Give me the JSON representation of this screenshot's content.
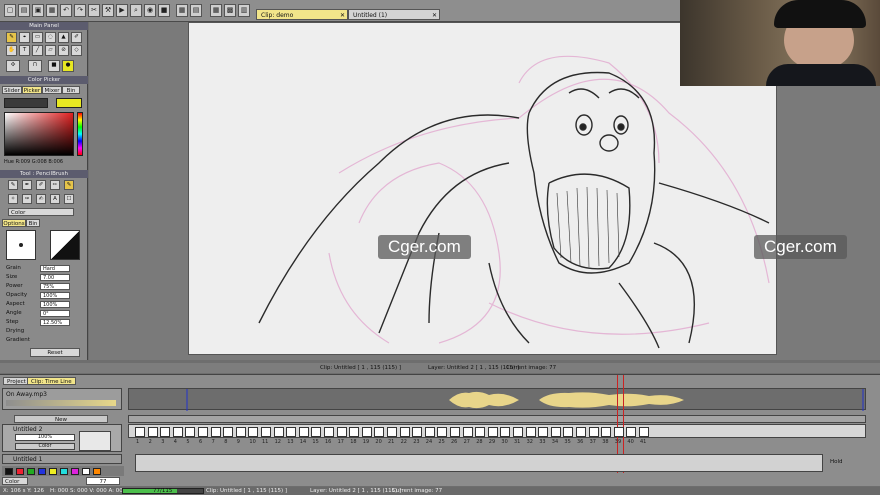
{
  "toolbar": {
    "tabs": [
      {
        "label": "Clip: demo",
        "active": true
      },
      {
        "label": "Untitled (1)",
        "active": false
      }
    ],
    "buttons": [
      "new",
      "open",
      "save",
      "undo",
      "redo",
      "zoom-in",
      "zoom-out",
      "rotate",
      "fit",
      "grid",
      "light-table"
    ]
  },
  "panels": {
    "main_panel": {
      "title": "Main Panel"
    },
    "color_picker": {
      "title": "Color Picker",
      "tabs": [
        "Slider",
        "Picker",
        "Mixer",
        "Bin"
      ],
      "active_tab": "Picker",
      "hsb_readout": "Hue R:009 G:008 B:006",
      "current_color": "#e8e822",
      "foreground": "#3a3a3a"
    },
    "tool": {
      "title": "Tool : PencilBrush",
      "color_select": "Color",
      "tabs": [
        "Options",
        "Bin"
      ],
      "active_tab": "Options",
      "fields": [
        {
          "label": "Grain",
          "value": "Hard"
        },
        {
          "label": "Size",
          "value": "7.00"
        },
        {
          "label": "Power",
          "value": "75%"
        },
        {
          "label": "Opacity",
          "value": "100%"
        },
        {
          "label": "Aspect",
          "value": "100%"
        },
        {
          "label": "Angle",
          "value": "0°"
        },
        {
          "label": "Step",
          "value": "12.50%"
        },
        {
          "label": "Drying",
          "value": ""
        },
        {
          "label": "Gradient",
          "value": ""
        }
      ],
      "reset_label": "Reset"
    }
  },
  "watermarks": [
    "Cger.com",
    "Cger.com"
  ],
  "mid_status": {
    "clip": "Clip: Untitled  [ 1 , 115  (115) ]",
    "layer": "Layer: Untitled 2  [ 1 , 115  (115) ]",
    "image": "Current image: 77"
  },
  "timeline": {
    "tabs": [
      "Project",
      "Clip: Time Line"
    ],
    "active_tab": "Clip: Time Line",
    "audio_track": {
      "name": "On Away.mp3"
    },
    "new_label": "New",
    "layer1": {
      "name": "Untitled 2",
      "opacity": "100%",
      "mode": "Color"
    },
    "layer2": {
      "name": "Untitled 1"
    },
    "color_select": "Color",
    "frame_field": "77",
    "hold_label": "Hold",
    "ticks": [
      "1",
      "2",
      "3",
      "4",
      "5",
      "6",
      "7",
      "8",
      "9",
      "10",
      "11",
      "12",
      "13",
      "14",
      "15",
      "16",
      "17",
      "18",
      "19",
      "20",
      "21",
      "22",
      "23",
      "24",
      "25",
      "26",
      "27",
      "28",
      "29",
      "30",
      "31",
      "32",
      "33",
      "34",
      "35",
      "36",
      "37",
      "38",
      "39",
      "40",
      "41"
    ]
  },
  "bottom_status": {
    "coords": "X: 106 s  Y: 126",
    "hsv": "H: 000  S: 000  V: 000  A: 000",
    "progress_text": "77/115",
    "progress": 0.67,
    "clip": "Clip: Untitled  [ 1 , 115  (115) ]",
    "layer": "Layer: Untitled 2  [ 1 , 115  (115) ]",
    "image": "Current image: 77"
  }
}
